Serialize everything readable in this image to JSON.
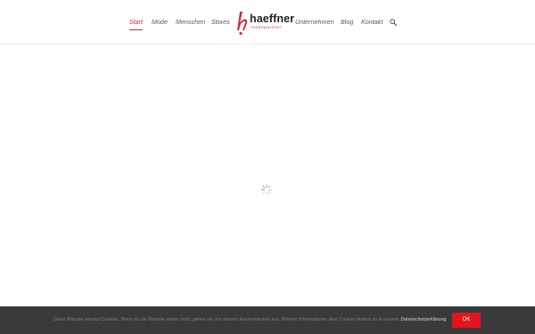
{
  "nav": {
    "items": [
      "Start",
      "Mode",
      "Menschen",
      "Stores",
      "Unternehmen",
      "Blog",
      "Kontakt"
    ],
    "active": "Start",
    "accent_color": "#c8313a"
  },
  "logo": {
    "name": "haeffner",
    "subtitle": "modepartner"
  },
  "icons": {
    "search": "search-icon",
    "loading": "spinner-icon"
  },
  "cookie": {
    "text": "Diese Website benutzt Cookies. Wenn du die Website weiter nutzt, gehen wir von deinem Einverständnis aus. Weitere Informationen über Cookies findest du in unserer",
    "link_label": "Datenschutzerklärung",
    "ok_label": "OK",
    "button_color": "#e1161c"
  }
}
